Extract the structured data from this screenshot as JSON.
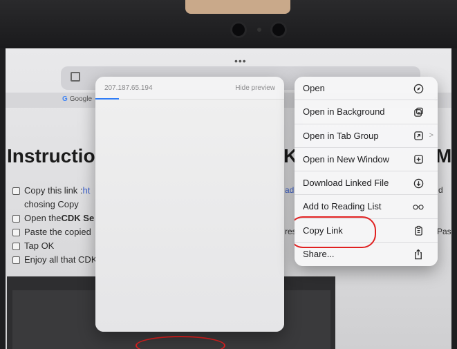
{
  "background_page": {
    "google_tab_label": "Google",
    "right_tab_fragment": "s",
    "heading_left": "Instructio",
    "heading_right_fragment": "K",
    "heading_far_right_fragment": "M",
    "instructions": [
      {
        "text": "Copy this link : ",
        "link_fragment": "ht"
      },
      {
        "text": "chosing Copy"
      },
      {
        "text": "Open the ",
        "bold": "CDK Se"
      },
      {
        "text": "Paste the copied"
      },
      {
        "text": "Tap OK"
      },
      {
        "text": "Enjoy all that CDK"
      }
    ],
    "right_fragments": [
      "ad",
      "d",
      "res",
      "Pas"
    ]
  },
  "link_preview": {
    "url": "207.187.65.194",
    "hide_label": "Hide preview"
  },
  "context_menu": {
    "items": [
      {
        "label": "Open",
        "icon": "compass-icon"
      },
      {
        "label": "Open in Background",
        "icon": "tabs-icon"
      },
      {
        "label": "Open in Tab Group",
        "icon": "tab-group-icon",
        "chevron": ">"
      },
      {
        "label": "Open in New Window",
        "icon": "new-window-icon"
      },
      {
        "label": "Download Linked File",
        "icon": "download-icon"
      },
      {
        "label": "Add to Reading List",
        "icon": "glasses-icon"
      },
      {
        "label": "Copy Link",
        "icon": "copy-icon",
        "highlighted": true
      },
      {
        "label": "Share...",
        "icon": "share-icon"
      }
    ]
  },
  "colors": {
    "annotation_red": "#e02020",
    "link_blue": "#3a5fcd",
    "progress_blue": "#2f7cf6"
  }
}
